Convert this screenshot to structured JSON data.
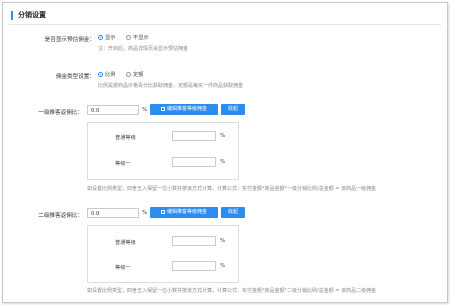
{
  "section": {
    "title": "分销设置"
  },
  "show_commission": {
    "label": "是否显示预估佣金：",
    "options": [
      "显示",
      "不显示"
    ],
    "note": "注：开启后，商品详情页会显示预估佣金"
  },
  "commission_type": {
    "label": "佣金类型设置：",
    "options": [
      "比例",
      "定额"
    ],
    "note": "比例是按商品价格百分比获取佣金，定额是每买一件商品获取佣金"
  },
  "level1": {
    "label": "一级推客返佣比：",
    "value": "0.0",
    "unit": "%",
    "edit_button": "编辑推客等级佣金",
    "collapse_button": "收起",
    "rows": [
      {
        "name": "普通等级",
        "unit": "%"
      },
      {
        "name": "等级一",
        "unit": "%"
      }
    ],
    "note": "如设置比例类型，四舍五入保留一位小数并按该方式计算。计算公式：实付金额*商品金额*一级分销比例/总金额 = 该商品一级佣金"
  },
  "level2": {
    "label": "二级推客返佣比：",
    "value": "0.0",
    "unit": "%",
    "edit_button": "编辑推客等级佣金",
    "collapse_button": "收起",
    "rows": [
      {
        "name": "普通等级",
        "unit": "%"
      },
      {
        "name": "等级一",
        "unit": "%"
      }
    ],
    "note": "如设置比例类型，四舍五入保留一位小数并按该方式计算。计算公式：实付金额*商品金额*二级分销比例/总金额 = 该商品二级佣金"
  },
  "colors": {
    "accent": "#2d8cf0",
    "border": "#dddddd",
    "note": "#888888"
  }
}
